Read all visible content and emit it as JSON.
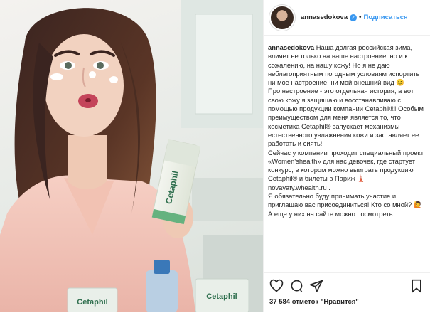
{
  "post": {
    "username": "annasedokova",
    "follow_label": "Подписаться",
    "caption_user": "annasedokova",
    "caption_paragraphs": [
      "Наша долгая российская зима, влияет не только на наше настроение, но и к сожалению, на нашу кожу! Но я не даю неблагоприятным погодным условиям испортить ни мое настроение, ни мой внешний вид 😊",
      "Про настроение - это отдельная история, а вот свою кожу я защищаю и восстанавливаю с помощью продукции компании Cetaphil®! Особым преимуществом для меня является то, что косметика Cetaphil® запускает механизмы естественного увлажнения кожи и заставляет ее работать и сиять!",
      "Сейчас у компании проходит специальный проект «Women'shealth» для нас девочек, где стартует конкурс, в котором можно выиграть продукцию Cetaphil® и билеты в Париж 🗼",
      "novayaty.whealth.ru .",
      "Я обязательно буду принимать участие и приглашаю вас присоединиться! Кто со мной? 🙋",
      "А еще у них на сайте можно посмотреть"
    ],
    "likes_text": "37 584 отметок \"Нравится\""
  },
  "photo": {
    "product_label": "Cetaphil"
  },
  "icons": {
    "verified": "verified-badge-icon",
    "like": "heart-icon",
    "comment": "comment-icon",
    "share": "share-icon",
    "save": "bookmark-icon"
  },
  "colors": {
    "link_blue": "#3897f0",
    "text": "#262626",
    "border": "#efefef"
  }
}
